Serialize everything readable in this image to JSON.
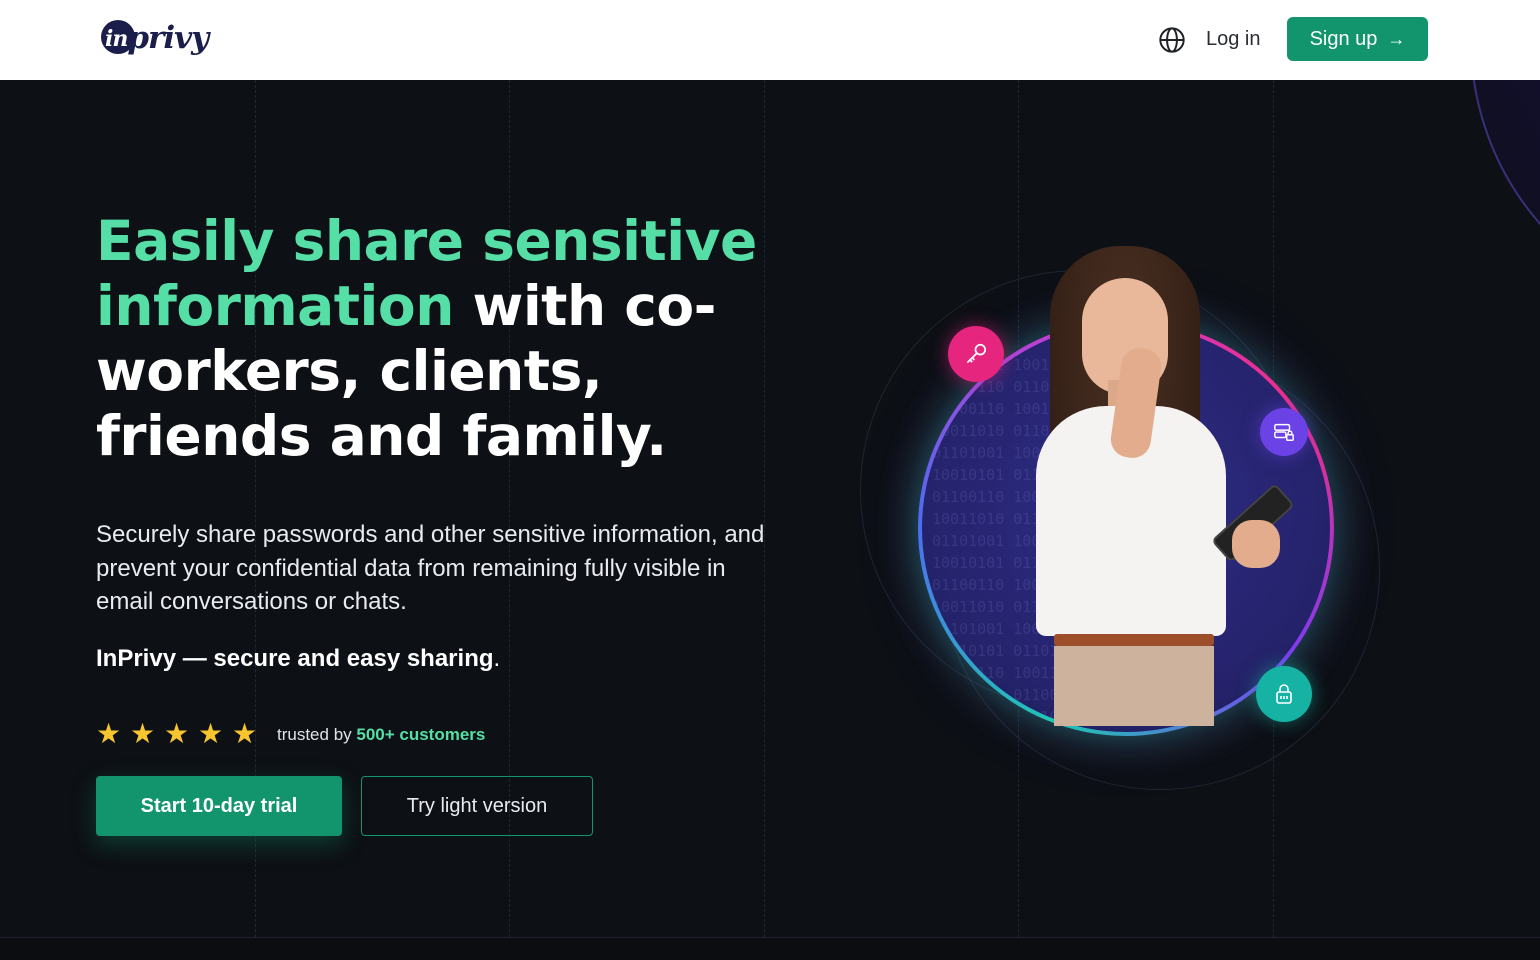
{
  "header": {
    "logo_text": "inprivy",
    "language_icon": "globe-icon",
    "login_label": "Log in",
    "signup_label": "Sign up",
    "signup_icon": "arrow-right-icon"
  },
  "hero": {
    "headline_accent": "Easily share sensitive information",
    "headline_rest": " with co-workers, clients, friends and family.",
    "description": "Securely share passwords and other sensitive information, and prevent your confidential data from remaining fully visible in email conversations or chats.",
    "tagline_bold": "InPrivy — secure and easy sharing",
    "tagline_end": ".",
    "rating_stars": 5,
    "trusted_prefix": "trusted by ",
    "trusted_highlight": "500+ customers",
    "primary_button": "Start 10-day trial",
    "secondary_button": "Try light version"
  },
  "illustration": {
    "badges": [
      "key-icon",
      "card-lock-icon",
      "lock-icon"
    ]
  },
  "colors": {
    "accent_green": "#55dfa6",
    "button_green": "#12956d",
    "background": "#0d1015",
    "star": "#f7c52d",
    "badge_pink": "#e5257e",
    "badge_purple": "#6b42e6",
    "badge_teal": "#16b2a3"
  }
}
